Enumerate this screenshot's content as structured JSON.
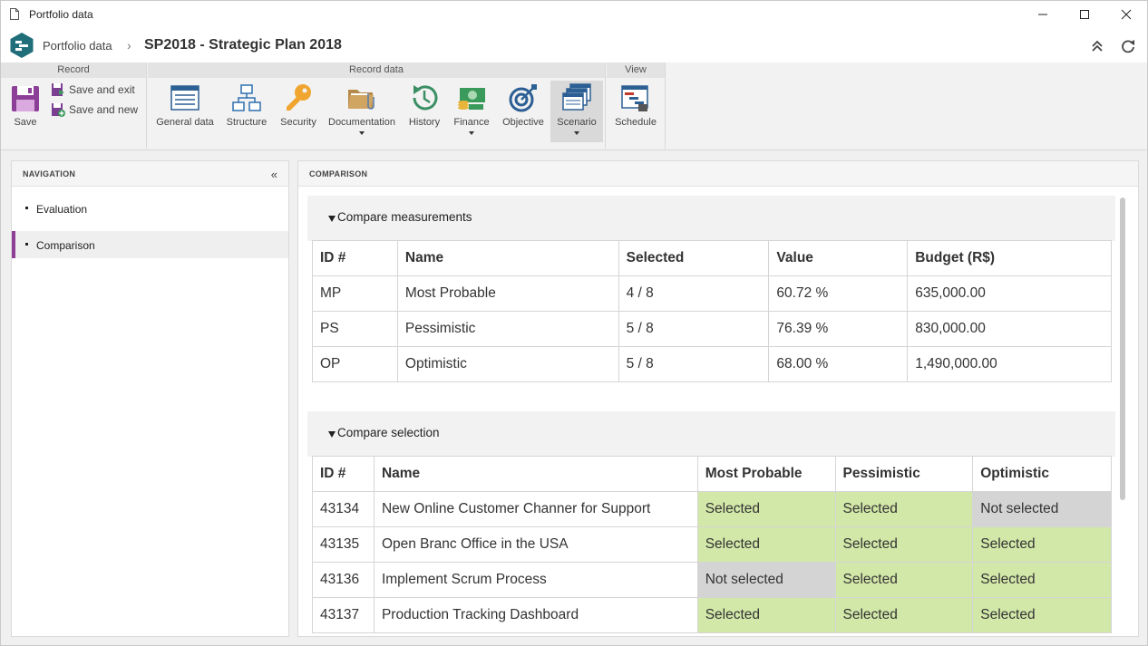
{
  "window": {
    "title": "Portfolio data",
    "minimize_label": "",
    "maximize_label": "",
    "close_label": ""
  },
  "header": {
    "breadcrumb_root": "Portfolio data",
    "breadcrumb_separator": "›",
    "breadcrumb_current": "SP2018 - Strategic Plan 2018"
  },
  "ribbon": {
    "groups": {
      "record": "Record",
      "record_data": "Record data",
      "view": "View"
    },
    "record": {
      "save": "Save",
      "save_and_exit": "Save and exit",
      "save_and_new": "Save and new"
    },
    "record_data": {
      "general_data": "General data",
      "structure": "Structure",
      "security": "Security",
      "documentation": "Documentation",
      "history": "History",
      "finance": "Finance",
      "objective": "Objective",
      "scenario": "Scenario"
    },
    "view": {
      "schedule": "Schedule"
    }
  },
  "navigation": {
    "title": "NAVIGATION",
    "collapse_glyph": "«",
    "items": [
      {
        "label": "Evaluation",
        "selected": false
      },
      {
        "label": "Comparison",
        "selected": true
      }
    ]
  },
  "comparison": {
    "title": "COMPARISON",
    "measurements": {
      "section_title": "Compare measurements",
      "columns": [
        "ID #",
        "Name",
        "Selected",
        "Value",
        "Budget (R$)"
      ],
      "rows": [
        [
          "MP",
          "Most Probable",
          "4 / 8",
          "60.72 %",
          "635,000.00"
        ],
        [
          "PS",
          "Pessimistic",
          "5 / 8",
          "76.39 %",
          "830,000.00"
        ],
        [
          "OP",
          "Optimistic",
          "5 / 8",
          "68.00 %",
          "1,490,000.00"
        ]
      ]
    },
    "selection": {
      "section_title": "Compare selection",
      "columns": [
        "ID #",
        "Name",
        "Most Probable",
        "Pessimistic",
        "Optimistic"
      ],
      "rows": [
        [
          "43134",
          "New Online Customer Channer for Support",
          "Selected",
          "Selected",
          "Not selected"
        ],
        [
          "43135",
          "Open Branc Office in the USA",
          "Selected",
          "Selected",
          "Selected"
        ],
        [
          "43136",
          "Implement Scrum Process",
          "Not selected",
          "Selected",
          "Selected"
        ],
        [
          "43137",
          "Production Tracking Dashboard",
          "Selected",
          "Selected",
          "Selected"
        ]
      ]
    }
  },
  "colors": {
    "accent": "#8f3f97",
    "selected_cell": "#d2e8a8",
    "not_selected_cell": "#d4d4d4",
    "logo": "#1f6e7a"
  }
}
